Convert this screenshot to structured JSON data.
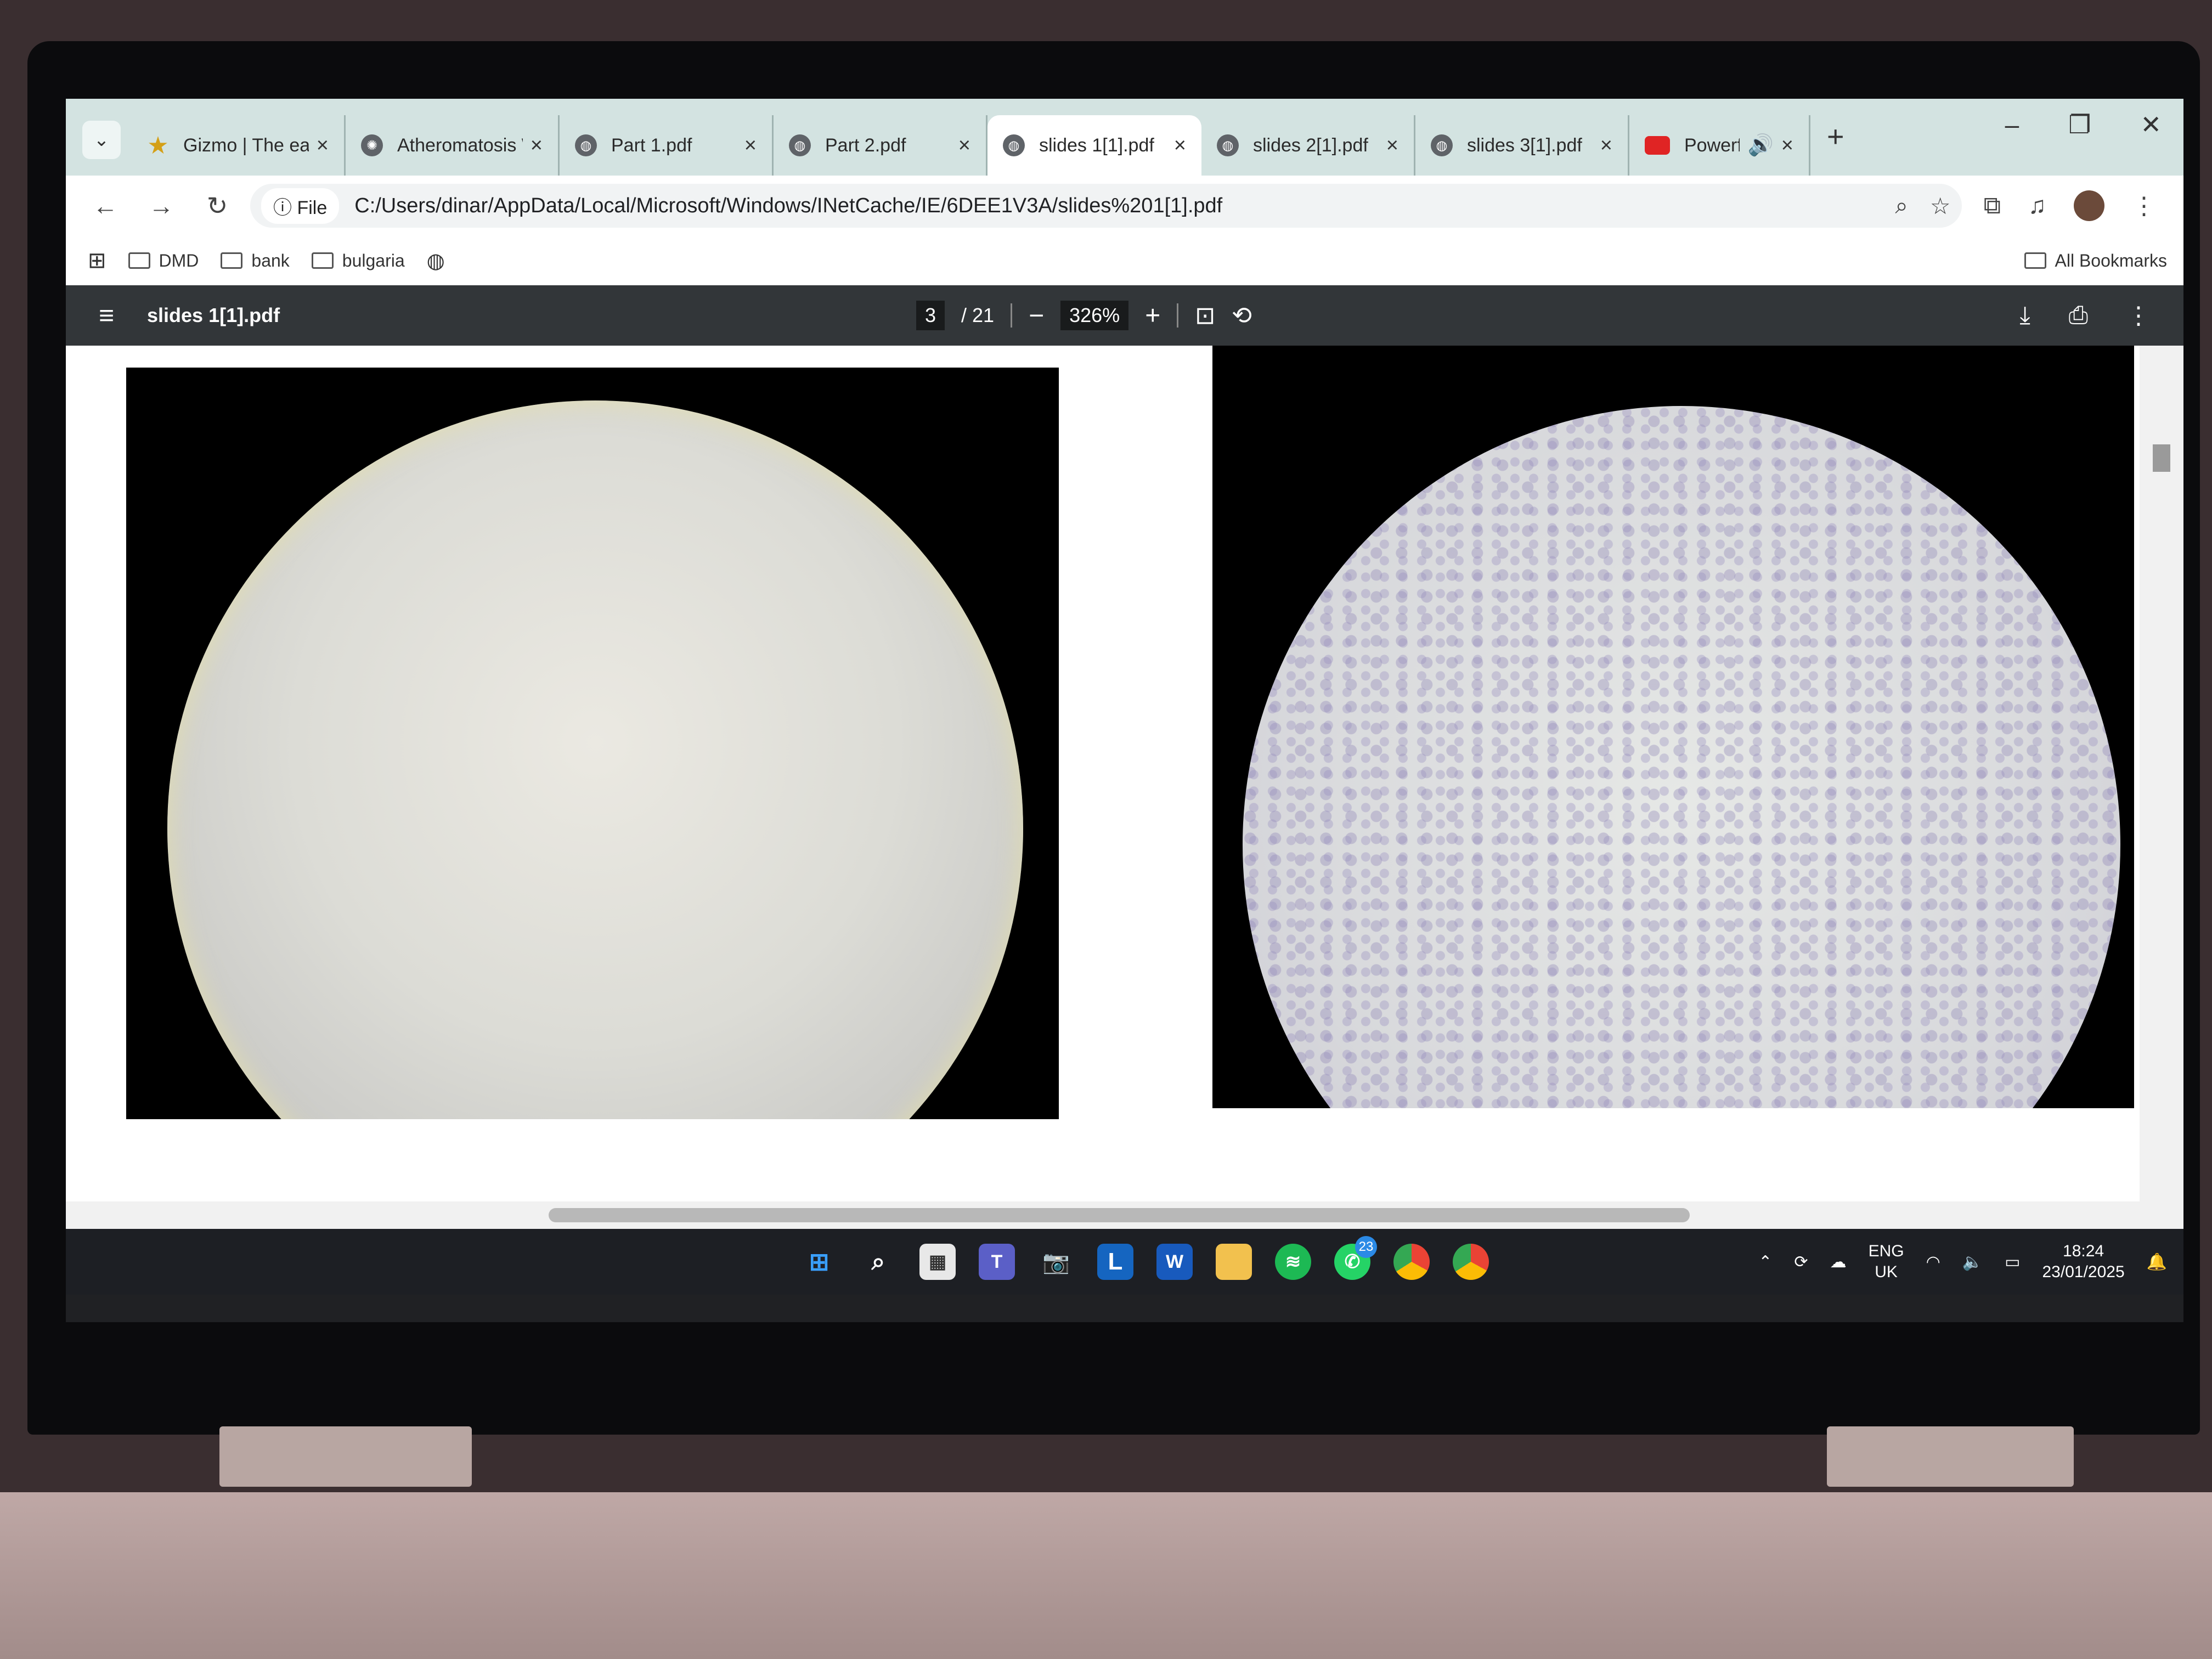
{
  "tabs": [
    {
      "label": "Gizmo | The easi",
      "icon": "star-icon",
      "active": false
    },
    {
      "label": "Atheromatosis W",
      "icon": "openai-icon",
      "active": false
    },
    {
      "label": "Part 1.pdf",
      "icon": "globe-icon",
      "active": false
    },
    {
      "label": "Part 2.pdf",
      "icon": "globe-icon",
      "active": false
    },
    {
      "label": "slides 1[1].pdf",
      "icon": "globe-icon",
      "active": true
    },
    {
      "label": "slides 2[1].pdf",
      "icon": "globe-icon",
      "active": false
    },
    {
      "label": "slides 3[1].pdf",
      "icon": "globe-icon",
      "active": false
    },
    {
      "label": "Powerful Du",
      "icon": "youtube-icon",
      "active": false
    }
  ],
  "address": {
    "chip": "File",
    "url": "C:/Users/dinar/AppData/Local/Microsoft/Windows/INetCache/IE/6DEE1V3A/slides%201[1].pdf"
  },
  "bookmarks": {
    "items": [
      "DMD",
      "bank",
      "bulgaria"
    ],
    "all_label": "All Bookmarks"
  },
  "pdf": {
    "title": "slides 1[1].pdf",
    "page_current": "3",
    "page_total": "/ 21",
    "zoom": "326%"
  },
  "taskbar": {
    "apps": [
      "windows-start",
      "search",
      "store",
      "teams",
      "camera",
      "L",
      "word",
      "file-explorer",
      "spotify",
      "whatsapp",
      "chrome",
      "chrome-profile"
    ],
    "whatsapp_badge": "23",
    "lang_line1": "ENG",
    "lang_line2": "UK",
    "time": "18:24",
    "date": "23/01/2025"
  }
}
